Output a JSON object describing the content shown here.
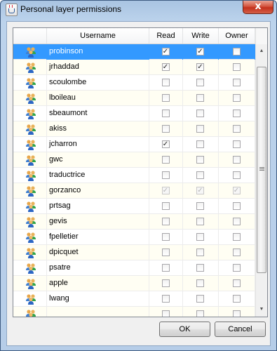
{
  "window": {
    "title": "Personal layer permissions",
    "close_symbol": "x"
  },
  "table": {
    "columns": [
      "",
      "Username",
      "Read",
      "Write",
      "Owner"
    ],
    "rows": [
      {
        "username": "probinson",
        "read": true,
        "write": true,
        "owner": false,
        "selected": true,
        "dim": false
      },
      {
        "username": "jrhaddad",
        "read": true,
        "write": true,
        "owner": false,
        "selected": false,
        "dim": false
      },
      {
        "username": "scoulombe",
        "read": false,
        "write": false,
        "owner": false,
        "selected": false,
        "dim": false
      },
      {
        "username": "lboileau",
        "read": false,
        "write": false,
        "owner": false,
        "selected": false,
        "dim": false
      },
      {
        "username": "sbeaumont",
        "read": false,
        "write": false,
        "owner": false,
        "selected": false,
        "dim": false
      },
      {
        "username": "akiss",
        "read": false,
        "write": false,
        "owner": false,
        "selected": false,
        "dim": false
      },
      {
        "username": "jcharron",
        "read": true,
        "write": false,
        "owner": false,
        "selected": false,
        "dim": false
      },
      {
        "username": "gwc",
        "read": false,
        "write": false,
        "owner": false,
        "selected": false,
        "dim": false
      },
      {
        "username": "traductrice",
        "read": false,
        "write": false,
        "owner": false,
        "selected": false,
        "dim": false
      },
      {
        "username": "gorzanco",
        "read": true,
        "write": true,
        "owner": true,
        "selected": false,
        "dim": true
      },
      {
        "username": "prtsag",
        "read": false,
        "write": false,
        "owner": false,
        "selected": false,
        "dim": false
      },
      {
        "username": "gevis",
        "read": false,
        "write": false,
        "owner": false,
        "selected": false,
        "dim": false
      },
      {
        "username": "fpelletier",
        "read": false,
        "write": false,
        "owner": false,
        "selected": false,
        "dim": false
      },
      {
        "username": "dpicquet",
        "read": false,
        "write": false,
        "owner": false,
        "selected": false,
        "dim": false
      },
      {
        "username": "psatre",
        "read": false,
        "write": false,
        "owner": false,
        "selected": false,
        "dim": false
      },
      {
        "username": "apple",
        "read": false,
        "write": false,
        "owner": false,
        "selected": false,
        "dim": false
      },
      {
        "username": "lwang",
        "read": false,
        "write": false,
        "owner": false,
        "selected": false,
        "dim": false
      },
      {
        "username": "",
        "read": false,
        "write": false,
        "owner": false,
        "selected": false,
        "dim": false
      }
    ]
  },
  "buttons": {
    "ok": "OK",
    "cancel": "Cancel"
  },
  "icons": {
    "row_icon": "user-group-icon",
    "title_icon": "java-cup-icon"
  },
  "colors": {
    "selection": "#3399ff",
    "close_button": "#c4301c"
  }
}
